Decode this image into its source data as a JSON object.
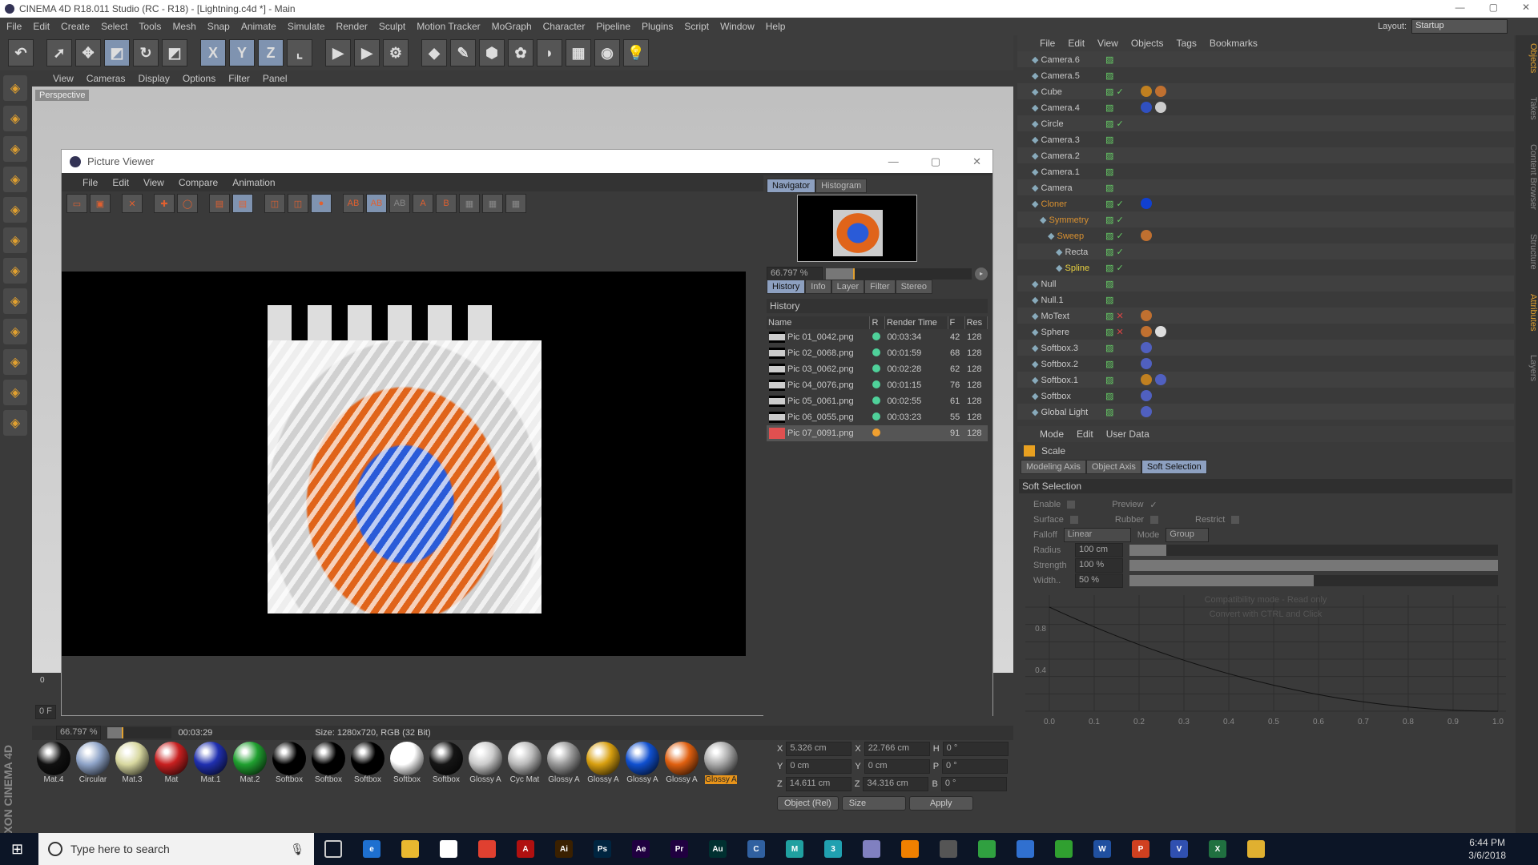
{
  "app": {
    "title": "CINEMA 4D R18.011 Studio (RC - R18) - [Lightning.c4d *] - Main",
    "layout_label": "Layout:",
    "layout_value": "Startup"
  },
  "menu": [
    "File",
    "Edit",
    "Create",
    "Select",
    "Tools",
    "Mesh",
    "Snap",
    "Animate",
    "Simulate",
    "Render",
    "Sculpt",
    "Motion Tracker",
    "MoGraph",
    "Character",
    "Pipeline",
    "Plugins",
    "Script",
    "Window",
    "Help"
  ],
  "toolbar": {
    "icons": [
      "undo-icon",
      "live-selection-icon",
      "move-icon",
      "scale-icon",
      "rotate-icon",
      "last-tool-icon",
      "x-axis-icon",
      "y-axis-icon",
      "z-axis-icon",
      "coordinate-system-icon",
      "render-view-icon",
      "render-pv-icon",
      "render-settings-icon",
      "cube-icon",
      "pen-icon",
      "subdivision-icon",
      "cloner-icon",
      "deformer-icon",
      "floor-icon",
      "camera-icon",
      "light-icon"
    ],
    "xyz": [
      "X",
      "Y",
      "Z"
    ]
  },
  "viewport": {
    "menu": [
      "View",
      "Cameras",
      "Display",
      "Options",
      "Filter",
      "Panel"
    ],
    "label": "Perspective"
  },
  "picture_viewer": {
    "title": "Picture Viewer",
    "menu": [
      "File",
      "Edit",
      "View",
      "Compare",
      "Animation"
    ],
    "nav_tabs": [
      "Navigator",
      "Histogram"
    ],
    "zoom": "66.797 %",
    "zoom_fraction": 0.2,
    "tabs": [
      "History",
      "Info",
      "Layer",
      "Filter",
      "Stereo"
    ],
    "history_label": "History",
    "columns": [
      "Name",
      "R",
      "Render Time",
      "F",
      "Res"
    ],
    "rows": [
      {
        "name": "Pic 01_0042.png",
        "status": "#4fd19a",
        "time": "00:03:34",
        "f": "42",
        "res": "128"
      },
      {
        "name": "Pic 02_0068.png",
        "status": "#4fd19a",
        "time": "00:01:59",
        "f": "68",
        "res": "128"
      },
      {
        "name": "Pic 03_0062.png",
        "status": "#4fd19a",
        "time": "00:02:28",
        "f": "62",
        "res": "128"
      },
      {
        "name": "Pic 04_0076.png",
        "status": "#4fd19a",
        "time": "00:01:15",
        "f": "76",
        "res": "128"
      },
      {
        "name": "Pic 05_0061.png",
        "status": "#4fd19a",
        "time": "00:02:55",
        "f": "61",
        "res": "128"
      },
      {
        "name": "Pic 06_0055.png",
        "status": "#4fd19a",
        "time": "00:03:23",
        "f": "55",
        "res": "128"
      },
      {
        "name": "Pic 07_0091.png",
        "status": "#f0a030",
        "time": "",
        "f": "91",
        "res": "128"
      }
    ],
    "status": {
      "zoom": "66.797 %",
      "time": "00:03:29",
      "size": "Size: 1280x720, RGB (32 Bit)"
    }
  },
  "timeline": {
    "frame": "0 F",
    "start": "0"
  },
  "materials": [
    {
      "name": "Mat.4",
      "color": "#111"
    },
    {
      "name": "Circular",
      "color": "#8fa4c8"
    },
    {
      "name": "Mat.3",
      "color": "#d8d8a0"
    },
    {
      "name": "Mat",
      "color": "#c82020"
    },
    {
      "name": "Mat.1",
      "color": "#2030b0"
    },
    {
      "name": "Mat.2",
      "color": "#20a030"
    },
    {
      "name": "Softbox",
      "color": "#000"
    },
    {
      "name": "Softbox",
      "color": "#000"
    },
    {
      "name": "Softbox",
      "color": "#000"
    },
    {
      "name": "Softbox",
      "color": "#fff"
    },
    {
      "name": "Softbox",
      "color": "#151515"
    },
    {
      "name": "Glossy A",
      "color": "#ccc"
    },
    {
      "name": "Cyc Mat",
      "color": "#bbb"
    },
    {
      "name": "Glossy A",
      "color": "#999"
    },
    {
      "name": "Glossy A",
      "color": "#d8a010"
    },
    {
      "name": "Glossy A",
      "color": "#1050d0"
    },
    {
      "name": "Glossy A",
      "color": "#e06010"
    },
    {
      "name": "Glossy A",
      "color": "#aaa",
      "selected": true
    }
  ],
  "coordinates": {
    "rows": [
      [
        "X",
        "5.326 cm",
        "X",
        "22.766 cm",
        "H",
        "0 °"
      ],
      [
        "Y",
        "0 cm",
        "Y",
        "0 cm",
        "P",
        "0 °"
      ],
      [
        "Z",
        "14.611 cm",
        "Z",
        "34.316 cm",
        "B",
        "0 °"
      ]
    ],
    "mode": "Object (Rel)",
    "size": "Size",
    "apply": "Apply"
  },
  "object_manager": {
    "menu": [
      "File",
      "Edit",
      "View",
      "Objects",
      "Tags",
      "Bookmarks"
    ],
    "objects": [
      {
        "name": "Camera.6",
        "icon": "camera-icon",
        "check": ""
      },
      {
        "name": "Camera.5",
        "icon": "camera-icon",
        "check": ""
      },
      {
        "name": "Cube",
        "icon": "cube-icon",
        "check": "✓",
        "tags": [
          "#c08020",
          "#c07030"
        ]
      },
      {
        "name": "Camera.4",
        "icon": "camera-icon",
        "check": "",
        "tags": [
          "#3050c0",
          "#ccc"
        ]
      },
      {
        "name": "Circle",
        "icon": "circle-icon",
        "check": "✓"
      },
      {
        "name": "Camera.3",
        "icon": "camera-icon",
        "check": ""
      },
      {
        "name": "Camera.2",
        "icon": "camera-icon",
        "check": ""
      },
      {
        "name": "Camera.1",
        "icon": "camera-icon",
        "check": ""
      },
      {
        "name": "Camera",
        "icon": "camera-icon",
        "check": ""
      },
      {
        "name": "Cloner",
        "icon": "cloner-icon",
        "check": "✓",
        "orange": true,
        "tags": [
          "#1040d0"
        ]
      },
      {
        "name": "Symmetry",
        "icon": "symmetry-icon",
        "check": "✓",
        "orange": true,
        "indent": 1
      },
      {
        "name": "Sweep",
        "icon": "sweep-icon",
        "check": "✓",
        "orange": true,
        "indent": 2,
        "tags": [
          "#c07030"
        ]
      },
      {
        "name": "Recta",
        "icon": "rectangle-icon",
        "check": "✓",
        "indent": 3
      },
      {
        "name": "Spline",
        "icon": "spline-icon",
        "check": "✓",
        "yellow": true,
        "indent": 3
      },
      {
        "name": "Null",
        "icon": "null-icon",
        "check": ""
      },
      {
        "name": "Null.1",
        "icon": "null-icon",
        "check": ""
      },
      {
        "name": "MoText",
        "icon": "motext-icon",
        "check": "✕",
        "tags": [
          "#c07030"
        ]
      },
      {
        "name": "Sphere",
        "icon": "sphere-icon",
        "check": "✕",
        "tags": [
          "#c07030",
          "#ddd"
        ]
      },
      {
        "name": "Softbox.3",
        "icon": "null-icon",
        "check": "",
        "tags": [
          "#5060c0"
        ]
      },
      {
        "name": "Softbox.2",
        "icon": "null-icon",
        "check": "",
        "tags": [
          "#5060c0"
        ]
      },
      {
        "name": "Softbox.1",
        "icon": "null-icon",
        "check": "",
        "tags": [
          "#c08020",
          "#5060c0"
        ]
      },
      {
        "name": "Softbox",
        "icon": "null-icon",
        "check": "",
        "tags": [
          "#5060c0"
        ]
      },
      {
        "name": "Global Light",
        "icon": "null-icon",
        "check": "",
        "tags": [
          "#5060c0"
        ]
      }
    ]
  },
  "side_tabs": [
    "Objects",
    "Takes",
    "Content Browser",
    "Structure",
    "Attributes",
    "Layers"
  ],
  "attributes": {
    "menu": [
      "Mode",
      "Edit",
      "User Data"
    ],
    "tool": "Scale",
    "tabs": [
      "Modeling Axis",
      "Object Axis",
      "Soft Selection"
    ],
    "section": "Soft Selection",
    "enable": "Enable",
    "preview": "Preview",
    "surface": "Surface",
    "rubber": "Rubber",
    "restrict": "Restrict",
    "falloff_label": "Falloff",
    "falloff": "Linear",
    "mode_label": "Mode",
    "mode": "Group",
    "radius_label": "Radius",
    "radius": "100 cm",
    "radius_fraction": 0.1,
    "strength_label": "Strength",
    "strength": "100 %",
    "strength_fraction": 1.0,
    "width_label": "Width..",
    "width": "50 %",
    "width_fraction": 0.5,
    "graph_note1": "Compatibility mode - Read only",
    "graph_note2": "Convert with CTRL and Click",
    "graph_x": [
      "0.0",
      "0.1",
      "0.2",
      "0.3",
      "0.4",
      "0.5",
      "0.6",
      "0.7",
      "0.8",
      "0.9",
      "1.0"
    ],
    "graph_y": [
      "0.8",
      "0.4"
    ]
  },
  "taskbar": {
    "search": "Type here to search",
    "time": "6:44 PM",
    "date": "3/6/2018",
    "apps": [
      {
        "n": "edge",
        "c": "#1e70d0",
        "t": "e"
      },
      {
        "n": "explorer",
        "c": "#e8b830",
        "t": ""
      },
      {
        "n": "store",
        "c": "#fff",
        "t": ""
      },
      {
        "n": "chrome",
        "c": "#e04030",
        "t": ""
      },
      {
        "n": "acrobat",
        "c": "#b01010",
        "t": "A"
      },
      {
        "n": "illustrator",
        "c": "#3a2000",
        "t": "Ai"
      },
      {
        "n": "photoshop",
        "c": "#002540",
        "t": "Ps"
      },
      {
        "n": "after-effects",
        "c": "#200040",
        "t": "Ae"
      },
      {
        "n": "premiere",
        "c": "#200040",
        "t": "Pr"
      },
      {
        "n": "audition",
        "c": "#003030",
        "t": "Au"
      },
      {
        "n": "cinema4d",
        "c": "#3060a0",
        "t": "C"
      },
      {
        "n": "maya",
        "c": "#20a0a0",
        "t": "M"
      },
      {
        "n": "3dsmax",
        "c": "#20a0b0",
        "t": "3"
      },
      {
        "n": "media",
        "c": "#8080c0",
        "t": ""
      },
      {
        "n": "vlc",
        "c": "#f08000",
        "t": ""
      },
      {
        "n": "app",
        "c": "#555",
        "t": ""
      },
      {
        "n": "app2",
        "c": "#30a040",
        "t": ""
      },
      {
        "n": "app3",
        "c": "#3070d0",
        "t": ""
      },
      {
        "n": "app4",
        "c": "#30a030",
        "t": ""
      },
      {
        "n": "word",
        "c": "#2050a0",
        "t": "W"
      },
      {
        "n": "powerpoint",
        "c": "#d04020",
        "t": "P"
      },
      {
        "n": "visio",
        "c": "#3050b0",
        "t": "V"
      },
      {
        "n": "excel",
        "c": "#207040",
        "t": "X"
      },
      {
        "n": "app5",
        "c": "#e0b030",
        "t": ""
      }
    ]
  }
}
